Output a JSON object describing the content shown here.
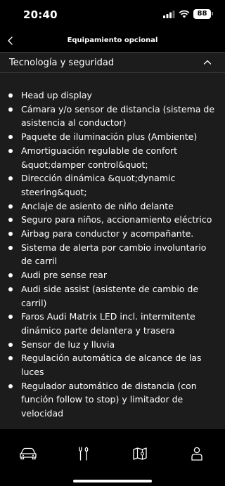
{
  "status_bar": {
    "time": "20:40",
    "battery": "88"
  },
  "header": {
    "title": "Equipamiento opcional"
  },
  "section": {
    "title": "Tecnología y seguridad",
    "items": [
      "Head up display",
      "Cámara y/o sensor de distancia (sistema de asistencia al conductor)",
      "Paquete de iluminación plus (Ambiente)",
      "Amortiguación regulable de confort &quot;damper control&quot;",
      "Dirección dinámica &quot;dynamic steering&quot;",
      "Anclaje de asiento de niño delante",
      "Seguro para niños, accionamiento eléctrico",
      "Airbag para conductor y acompañante.",
      "Sistema de alerta por cambio involuntario de carril",
      "Audi pre sense rear",
      "Audi side assist (asistente de cambio de carril)",
      "Faros Audi Matrix LED incl. intermitente dinámico parte delantera y trasera",
      "Sensor de luz y lluvia",
      "Regulación automática de alcance de las luces",
      "Regulador automático de distancia (con función follow to stop) y limitador de velocidad"
    ]
  },
  "tab_bar": {
    "tabs": [
      {
        "icon": "car-icon"
      },
      {
        "icon": "tools-icon"
      },
      {
        "icon": "map-icon"
      },
      {
        "icon": "profile-icon"
      }
    ]
  }
}
